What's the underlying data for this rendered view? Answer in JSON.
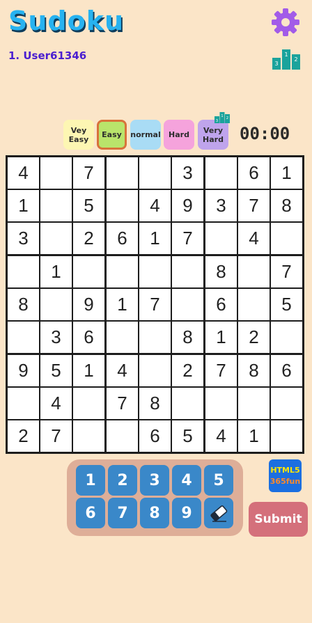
{
  "header": {
    "title": "Sudoku",
    "user": "1. User61346",
    "settings_icon": "gear-icon",
    "leaderboard_icon": "podium-icon",
    "podium_ranks": [
      "3",
      "1",
      "2"
    ]
  },
  "difficulty": {
    "options": [
      {
        "label": "Vey\nEasy",
        "color": "#fdf6b3",
        "selected": false
      },
      {
        "label": "Easy",
        "color": "#b9e46b",
        "selected": true
      },
      {
        "label": "normal",
        "color": "#a9dcf5",
        "selected": false
      },
      {
        "label": "Hard",
        "color": "#f5a3dc",
        "selected": false
      },
      {
        "label": "Very\nHard",
        "color": "#bfa4ec",
        "selected": false
      }
    ],
    "selected_border_color": "#d8733a"
  },
  "timer": "00:00",
  "board": [
    [
      "4",
      "",
      "7",
      "",
      "",
      "3",
      "",
      "6",
      "1"
    ],
    [
      "1",
      "",
      "5",
      "",
      "4",
      "9",
      "3",
      "7",
      "8"
    ],
    [
      "3",
      "",
      "2",
      "6",
      "1",
      "7",
      "",
      "4",
      ""
    ],
    [
      "",
      "1",
      "",
      "",
      "",
      "",
      "8",
      "",
      "7"
    ],
    [
      "8",
      "",
      "9",
      "1",
      "7",
      "",
      "6",
      "",
      "5"
    ],
    [
      "",
      "3",
      "6",
      "",
      "",
      "8",
      "1",
      "2",
      ""
    ],
    [
      "9",
      "5",
      "1",
      "4",
      "",
      "2",
      "7",
      "8",
      "6"
    ],
    [
      "",
      "4",
      "",
      "7",
      "8",
      "",
      "",
      "",
      ""
    ],
    [
      "2",
      "7",
      "",
      "",
      "6",
      "5",
      "4",
      "1",
      ""
    ]
  ],
  "keypad": {
    "keys": [
      "1",
      "2",
      "3",
      "4",
      "5",
      "6",
      "7",
      "8",
      "9"
    ],
    "eraser_icon": "eraser-icon"
  },
  "badge": {
    "line1": "HTML5",
    "line2": "365fun"
  },
  "submit_label": "Submit",
  "colors": {
    "background": "#fbe5c8",
    "title": "#27b2f0",
    "user": "#4a1ed0",
    "gear": "#a25be8",
    "podium": "#1ba39c",
    "key": "#3a88c9",
    "keypad_bg": "#deae98",
    "submit": "#d4707b"
  }
}
